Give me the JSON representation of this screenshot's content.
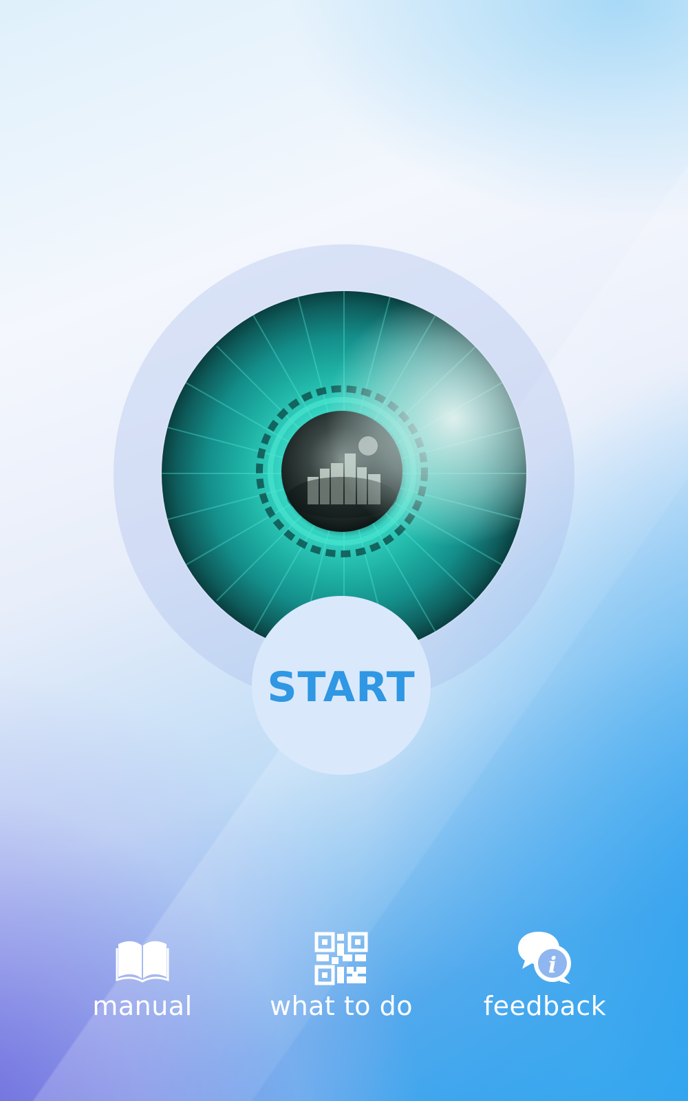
{
  "start_button": {
    "label": "START"
  },
  "bottom_nav": {
    "items": [
      {
        "label": "manual",
        "icon": "book-icon"
      },
      {
        "label": "what to do",
        "icon": "qr-code-icon"
      },
      {
        "label": "feedback",
        "icon": "chat-info-icon"
      }
    ]
  },
  "colors": {
    "accent": "#2f97e3",
    "nav_text": "#ffffff",
    "start_bg": "#d9e9fb"
  }
}
